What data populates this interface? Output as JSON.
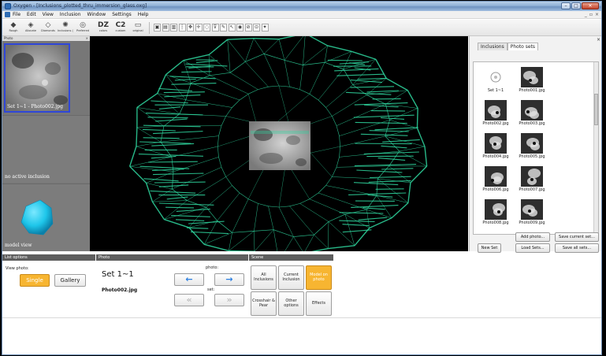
{
  "window": {
    "title": "Oxygen - [Inclusions_plotted_thru_immersion_glass.oxg]",
    "controls": {
      "minimize": "–",
      "maximize": "□",
      "close": "✕"
    },
    "mdi_controls": [
      "_",
      "▫",
      "×"
    ]
  },
  "menu": [
    "File",
    "Edit",
    "View",
    "Inclusion",
    "Window",
    "Settings",
    "Help"
  ],
  "toolbar": {
    "buttons": [
      {
        "label": "Rough",
        "icon": "rough-diamond-icon"
      },
      {
        "label": "Allocate",
        "icon": "allocate-icon"
      },
      {
        "label": "Diamonds",
        "icon": "diamonds-icon"
      },
      {
        "label": "Inclusions (Quicklist)",
        "icon": "inclusions-icon"
      },
      {
        "label": "Preferred",
        "icon": "preferred-icon"
      },
      {
        "label": "colors",
        "big": "DZ"
      },
      {
        "label": "custom",
        "big": "C2"
      },
      {
        "label": "original",
        "icon": "original-icon"
      }
    ],
    "small_tools": [
      "▣",
      "▤",
      "▥",
      "┆",
      "✥",
      "✛",
      "◌",
      "⊽",
      "✎",
      "↖",
      "◉",
      "⊘",
      "⊙",
      "✦"
    ]
  },
  "left_panel": {
    "header": "Photo",
    "close": "×",
    "photo_caption": "Set 1~1 - Photo002.jpg",
    "inclusion_caption": "no active inclusion",
    "model_caption": "model view"
  },
  "right_panel": {
    "tabs": [
      "Inclusions",
      "Photo sets"
    ],
    "active_tab": "Photo sets",
    "close": "×",
    "items": [
      {
        "label": "Set 1~1",
        "kind": "set"
      },
      {
        "label": "Photo001.jpg",
        "kind": "photo"
      },
      {
        "label": "Photo002.jpg",
        "kind": "photo"
      },
      {
        "label": "Photo003.jpg",
        "kind": "photo"
      },
      {
        "label": "Photo004.jpg",
        "kind": "photo"
      },
      {
        "label": "Photo005.jpg",
        "kind": "photo"
      },
      {
        "label": "Photo006.jpg",
        "kind": "photo"
      },
      {
        "label": "Photo007.jpg",
        "kind": "photo"
      },
      {
        "label": "Photo008.jpg",
        "kind": "photo"
      },
      {
        "label": "Photo009.jpg",
        "kind": "photo"
      }
    ],
    "buttons": {
      "add_photo": "Add photo...",
      "save_current_set": "Save current set...",
      "new_set": "New Set",
      "load_sets": "Load Sets...",
      "save_all_sets": "Save all sets..."
    }
  },
  "bottom": {
    "list_options": {
      "header": "List options",
      "view_photo_label": "View photo:",
      "single": "Single",
      "gallery": "Gallery",
      "active": "Single"
    },
    "photo": {
      "header": "Photo",
      "set_title": "Set 1~1",
      "filename": "Photo002.jpg",
      "photo_label": "photo:",
      "set_label": "set:",
      "prev_photo": "←",
      "next_photo": "→",
      "prev_set": "«",
      "next_set": "»"
    },
    "scene": {
      "header": "Scene",
      "all_inclusions": "All Inclusions",
      "current_inclusion": "Current Inclusion",
      "model_on_photo": "Model on photo",
      "crosshair_pear": "Crosshair & Pear",
      "other_options": "Other options",
      "effects": "Effects",
      "active": "Model on photo"
    }
  },
  "colors": {
    "accent_orange": "#f7b531",
    "wireframe_green": "#2fd8a0",
    "selection_blue": "#2f46d8",
    "arrow_blue": "#2c7fe0",
    "model_cyan": "#1ec6ea"
  }
}
